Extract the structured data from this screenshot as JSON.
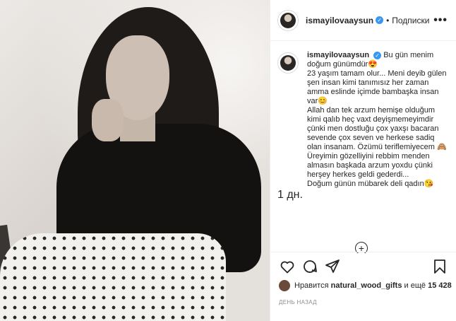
{
  "post": {
    "username": "ismayilovaaysun",
    "follow_label": "Подписки",
    "more_glyph": "•••",
    "caption_username": "ismayilovaaysun",
    "caption_text": "Bu gün menim doğum günümdür😍\n23 yaşım tamam olur... Meni deyib gülen şen insan kimi tanımısız her zaman amma eslinde içimde bambaşka insan var😊\nAllah dan tek arzum hemişe olduğum kimi qalıb heç vaxt deyişmemeyimdir çünki men dostluğu çox yaxşı bacaran sevende çox seven ve herkese sadiq olan insanam. Özümü teriflemiyecem 🙈 Üreyimin gözelliyini rebbim menden almasın başkada arzum yoxdu çünki herşey herkes geldi gederdi...\nDoğum günün mübarek deli qadın😘",
    "caption_time": "1 дн.",
    "load_more_glyph": "+",
    "likes_prefix": "Нравится",
    "likes_user": "natural_wood_gifts",
    "likes_and": "и ещё",
    "likes_count": "15 428",
    "posted_ago": "ДЕНЬ НАЗАД"
  },
  "icons": [
    "heart-icon",
    "comment-icon",
    "share-icon",
    "bookmark-icon",
    "verified-badge-icon"
  ],
  "colors": {
    "verified": "#3897f0",
    "muted": "#8e8e8e",
    "text": "#262626",
    "border": "#efefef"
  }
}
